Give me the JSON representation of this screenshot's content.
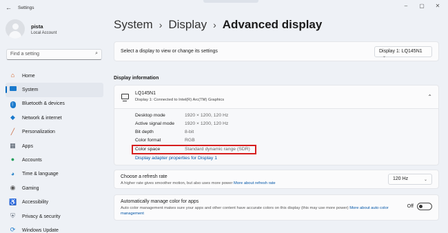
{
  "window": {
    "title": "Settings"
  },
  "user": {
    "name": "pista",
    "account": "Local Account"
  },
  "search": {
    "placeholder": "Find a setting"
  },
  "nav": [
    {
      "label": "Home",
      "icon": "home-icon",
      "active": false
    },
    {
      "label": "System",
      "icon": "system-icon",
      "active": true
    },
    {
      "label": "Bluetooth & devices",
      "icon": "bluetooth-icon",
      "active": false
    },
    {
      "label": "Network & internet",
      "icon": "wifi-icon",
      "active": false
    },
    {
      "label": "Personalization",
      "icon": "brush-icon",
      "active": false
    },
    {
      "label": "Apps",
      "icon": "apps-icon",
      "active": false
    },
    {
      "label": "Accounts",
      "icon": "accounts-icon",
      "active": false
    },
    {
      "label": "Time & language",
      "icon": "globe-icon",
      "active": false
    },
    {
      "label": "Gaming",
      "icon": "gamepad-icon",
      "active": false
    },
    {
      "label": "Accessibility",
      "icon": "accessibility-icon",
      "active": false
    },
    {
      "label": "Privacy & security",
      "icon": "shield-icon",
      "active": false
    },
    {
      "label": "Windows Update",
      "icon": "update-icon",
      "active": false
    }
  ],
  "breadcrumb": {
    "part1": "System",
    "part2": "Display",
    "current": "Advanced display",
    "separator": "›"
  },
  "select_display": {
    "label": "Select a display to view or change its settings",
    "value": "Display 1: LQ145N1"
  },
  "display_info": {
    "heading": "Display information",
    "title": "LQ145N1",
    "subtitle": "Display 1: Connected to Intel(R) Arc(TM) Graphics",
    "rows": [
      {
        "key": "Desktop mode",
        "value": "1920 × 1200, 120 Hz"
      },
      {
        "key": "Active signal mode",
        "value": "1920 × 1200, 120 Hz"
      },
      {
        "key": "Bit depth",
        "value": "8-bit"
      },
      {
        "key": "Color format",
        "value": "RGB"
      },
      {
        "key": "Color space",
        "value": "Standard dynamic range (SDR)"
      }
    ],
    "adapter_link": "Display adapter properties for Display 1"
  },
  "refresh_rate": {
    "title": "Choose a refresh rate",
    "subtitle": "A higher rate gives smoother motion, but also uses more power",
    "link": "More about refresh rate",
    "value": "120 Hz"
  },
  "auto_color": {
    "title": "Automatically manage color for apps",
    "subtitle": "Auto color management makes sure your apps and other content have accurate colors on this display (this may use more power)",
    "link": "More about auto color management",
    "state": "Off"
  },
  "colors": {
    "accent": "#0067c0",
    "highlight": "#d61d1d",
    "link": "#0054a6"
  }
}
